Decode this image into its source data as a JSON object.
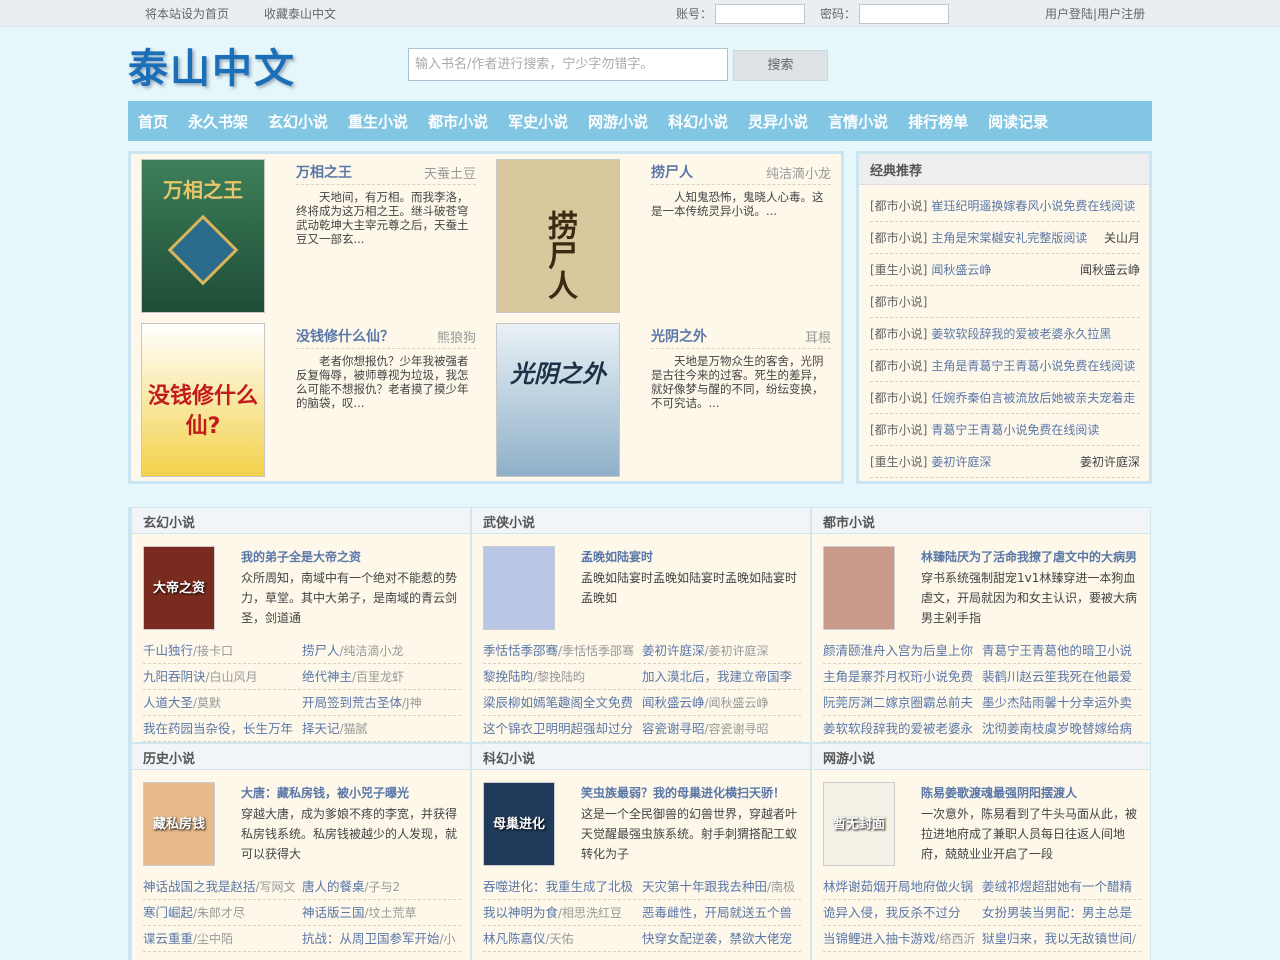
{
  "topbar": {
    "set_home": "将本站设为首页",
    "bookmark": "收藏泰山中文",
    "account_label": "账号：",
    "password_label": "密码：",
    "login": "用户登陆",
    "sep": "|",
    "register": "用户注册"
  },
  "header": {
    "logo": "泰山中文",
    "search_placeholder": "输入书名/作者进行搜索，宁少字勿错字。",
    "search_button": "搜索"
  },
  "nav": [
    "首页",
    "永久书架",
    "玄幻小说",
    "重生小说",
    "都市小说",
    "军史小说",
    "网游小说",
    "科幻小说",
    "灵异小说",
    "言情小说",
    "排行榜单",
    "阅读记录"
  ],
  "featured": [
    {
      "title": "万相之王",
      "author": "天蚕土豆",
      "desc": "天地间，有万相。而我李洛，终将成为这万相之王。继斗破苍穹武动乾坤大主宰元尊之后，天蚕土豆又一部玄...",
      "cover_text": "万相之王",
      "cover_color": "#2f6b4a"
    },
    {
      "title": "捞尸人",
      "author": "纯洁滴小龙",
      "desc": "人知鬼恐怖，鬼晓人心毒。这是一本传统灵异小说。...",
      "cover_text": "捞尸人",
      "cover_color": "#d9c89e"
    },
    {
      "title": "没钱修什么仙？",
      "author": "熊狼狗",
      "desc": "老者你想报仇？少年我被强者反复侮辱，被师尊视为垃圾，我怎么可能不想报仇？老者摸了摸少年的脑袋，叹...",
      "cover_text": "没钱修什么仙?",
      "cover_color": "#f3d24a"
    },
    {
      "title": "光阴之外",
      "author": "耳根",
      "desc": "天地是万物众生的客舍，光阴是古往今来的过客。死生的差异，就好像梦与醒的不同，纷纭变换，不可究诘。...",
      "cover_text": "光阴之外",
      "cover_color": "#aac4d8"
    }
  ],
  "sidebar": {
    "title": "经典推荐",
    "items": [
      {
        "cat": "[都市小说]",
        "title": "崔珏纪明遥换嫁春风小说免费在线阅读",
        "author": ""
      },
      {
        "cat": "[都市小说]",
        "title": "主角是宋棠樾安礼完整版阅读",
        "author": "关山月"
      },
      {
        "cat": "[重生小说]",
        "title": "闻秋盛云峥",
        "author": "闻秋盛云峥"
      },
      {
        "cat": "[都市小说]",
        "title": "",
        "author": ""
      },
      {
        "cat": "[都市小说]",
        "title": "姜软软段辞我的爱被老婆永久拉黑",
        "author": ""
      },
      {
        "cat": "[都市小说]",
        "title": "主角是青葛宁王青葛小说免费在线阅读",
        "author": ""
      },
      {
        "cat": "[都市小说]",
        "title": "任婉乔秦伯言被流放后她被亲夫宠着走",
        "author": ""
      },
      {
        "cat": "[都市小说]",
        "title": "青葛宁王青葛小说免费在线阅读",
        "author": ""
      },
      {
        "cat": "[重生小说]",
        "title": "姜初许庭深",
        "author": "姜初许庭深"
      }
    ]
  },
  "categories": [
    {
      "name": "玄幻小说",
      "top_title": "我的弟子全是大帝之资",
      "top_desc": "众所周知，南域中有一个绝对不能惹的势力，草堂。其中大弟子，是南域的青云剑圣，剑道通",
      "cover_text": "大帝之资",
      "cover_color": "#7a2b1f",
      "links": [
        [
          {
            "t": "千山独行",
            "a": "/接卡口"
          },
          {
            "t": "捞尸人",
            "a": "/纯洁滴小龙"
          }
        ],
        [
          {
            "t": "九阳吞阴诀",
            "a": "/白山风月"
          },
          {
            "t": "绝代神主",
            "a": "/百里龙虾"
          }
        ],
        [
          {
            "t": "人道大圣",
            "a": "/莫默"
          },
          {
            "t": "开局签到荒古圣体",
            "a": "/J神"
          }
        ],
        [
          {
            "t": "我在药园当杂役，长生万年",
            "a": ""
          },
          {
            "t": "择天记",
            "a": "/猫腻"
          }
        ]
      ]
    },
    {
      "name": "武侠小说",
      "top_title": "孟晚如陆宴时",
      "top_desc": "孟晚如陆宴时孟晚如陆宴时孟晚如陆宴时孟晚如",
      "cover_text": "",
      "cover_color": "#b9c6e8",
      "links": [
        [
          {
            "t": "季恬恬季邵骞",
            "a": "/季恬恬季邵骞"
          },
          {
            "t": "姜初许庭深",
            "a": "/姜初许庭深"
          }
        ],
        [
          {
            "t": "黎挽陆昀",
            "a": "/黎挽陆昀"
          },
          {
            "t": "加入漠北后，我建立帝国李",
            "a": ""
          }
        ],
        [
          {
            "t": "梁辰柳如嫣笔趣阁全文免费",
            "a": ""
          },
          {
            "t": "闻秋盛云峥",
            "a": "/闻秋盛云峥"
          }
        ],
        [
          {
            "t": "这个锦衣卫明明超强却过分",
            "a": ""
          },
          {
            "t": "容瓷谢寻昭",
            "a": "/容瓷谢寻昭"
          }
        ]
      ]
    },
    {
      "name": "都市小说",
      "top_title": "林臻陆厌为了活命我撩了虐文中的大病男",
      "top_desc": "穿书系统强制甜宠1v1林臻穿进一本狗血虐文，开局就因为和女主认识，要被大病男主剁手指",
      "cover_text": "",
      "cover_color": "#c99a8a",
      "links": [
        [
          {
            "t": "颜清颐淮舟入宫为后皇上你",
            "a": ""
          },
          {
            "t": "青葛宁王青葛他的暗卫小说",
            "a": ""
          }
        ],
        [
          {
            "t": "主角是寨芥月权珩小说免费",
            "a": ""
          },
          {
            "t": "裴鹤川赵云笙我死在他最爱",
            "a": ""
          }
        ],
        [
          {
            "t": "阮莞厉渊二嫁京圈霸总前夫",
            "a": ""
          },
          {
            "t": "墨少杰陆雨馨十分幸运外卖",
            "a": ""
          }
        ],
        [
          {
            "t": "姜软软段辞我的爱被老婆永",
            "a": ""
          },
          {
            "t": "沈彻姜南枝虞岁晚替嫁给病",
            "a": ""
          }
        ]
      ]
    },
    {
      "name": "历史小说",
      "top_title": "大唐：藏私房钱，被小兕子曝光",
      "top_desc": "穿越大唐，成为爹娘不疼的李宽，并获得私房钱系统。私房钱被越少的人发现，就可以获得大",
      "cover_text": "藏私房钱",
      "cover_color": "#e8b98a",
      "links": [
        [
          {
            "t": "神话战国之我是赵括",
            "a": "/写网文"
          },
          {
            "t": "唐人的餐桌",
            "a": "/子与2"
          }
        ],
        [
          {
            "t": "寒门崛起",
            "a": "/朱郎才尽"
          },
          {
            "t": "神话版三国",
            "a": "/坟土荒草"
          }
        ],
        [
          {
            "t": "谍云重重",
            "a": "/尘中陌"
          },
          {
            "t": "抗战：从周卫国参军开始",
            "a": "/小"
          }
        ]
      ]
    },
    {
      "name": "科幻小说",
      "top_title": "笑虫族最弱？我的母巢进化横扫天骄！",
      "top_desc": "这是一个全民御兽的幻兽世界，穿越者叶天觉醒最强虫族系统。射手刺猬搭配工蚁转化为子",
      "cover_text": "母巢进化",
      "cover_color": "#1f3a5a",
      "links": [
        [
          {
            "t": "吞噬进化：我重生成了北极",
            "a": ""
          },
          {
            "t": "天灾第十年跟我去种田",
            "a": "/南极"
          }
        ],
        [
          {
            "t": "我以神明为食",
            "a": "/相思洗红豆"
          },
          {
            "t": "恶毒雌性，开局就送五个兽",
            "a": ""
          }
        ],
        [
          {
            "t": "林凡陈嘉仪",
            "a": "/天佑"
          },
          {
            "t": "快穿女配逆袭，禁欲大佬宠",
            "a": ""
          }
        ]
      ]
    },
    {
      "name": "网游小说",
      "top_title": "陈易姜歌渡魂最强阴阳摆渡人",
      "top_desc": "一次意外，陈易看到了牛头马面从此，被拉进地府成了兼职人员每日往返人间地府，兢兢业业开启了一段",
      "cover_text": "暂无封面",
      "cover_color": "#f4f1e6",
      "links": [
        [
          {
            "t": "林烨谢茹烟开局地府做火锅",
            "a": ""
          },
          {
            "t": "姜绒祁煜超甜她有一个醋精",
            "a": ""
          }
        ],
        [
          {
            "t": "诡异入侵，我反杀不过分",
            "a": ""
          },
          {
            "t": "女扮男装当男配：男主总是",
            "a": ""
          }
        ],
        [
          {
            "t": "当锦鲤进入抽卡游戏",
            "a": "/络西沂"
          },
          {
            "t": "狱皇归来，我以无敌镇世间",
            "a": "/"
          }
        ]
      ]
    }
  ]
}
